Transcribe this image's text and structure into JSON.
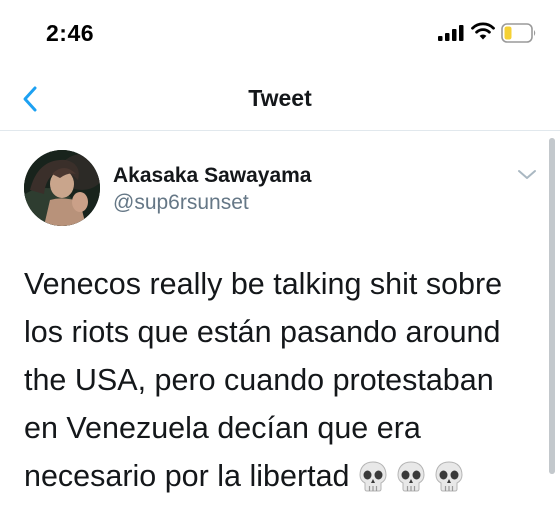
{
  "status_bar": {
    "time": "2:46",
    "icons": [
      "cellular-signal-icon",
      "wifi-icon",
      "battery-icon"
    ],
    "battery_color": "#f5d135"
  },
  "header": {
    "title": "Tweet",
    "back_icon": "chevron-left-icon",
    "accent_color": "#1da1f2"
  },
  "tweet": {
    "author": {
      "display_name": "Akasaka Sawayama",
      "handle": "@sup6rsunset",
      "avatar_icon": "profile-photo"
    },
    "menu_icon": "chevron-down-icon",
    "text_lines": [
      "Venecos really be talking shit sobre",
      "los riots que están pasando around",
      "the USA, pero cuando protestaban",
      "en Venezuela decían que era",
      "necesario por la libertad"
    ],
    "emoji": [
      "skull-emoji",
      "skull-emoji",
      "skull-emoji"
    ]
  }
}
